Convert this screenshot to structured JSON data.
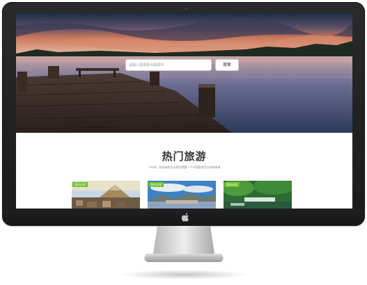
{
  "search": {
    "placeholder": "请输入旅游景点或城市",
    "button_label": "搜索"
  },
  "section": {
    "title": "热门旅游",
    "subtitle": "十年来，祝游诚实告诉我们想要一个中国国家官方的带来者"
  },
  "cards": [
    {
      "tag": "国内出境",
      "icon": "mountain-town-image"
    },
    {
      "tag": "国内出境",
      "icon": "alpine-lake-image"
    },
    {
      "tag": "国内出境",
      "icon": "waterfall-forest-image"
    }
  ],
  "icons": {
    "logo": "apple-icon"
  },
  "colors": {
    "tag_green": "#6bbf2a",
    "bezel": "#1e1e1e",
    "page_bg": "#ffffff"
  }
}
